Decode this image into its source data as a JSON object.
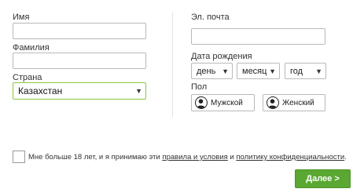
{
  "form": {
    "first_name_label": "Имя",
    "first_name_value": "",
    "last_name_label": "Фамилия",
    "last_name_value": "",
    "country_label": "Страна",
    "country_value": "Казахстан",
    "email_label": "Эл. почта",
    "email_value": "",
    "dob_label": "Дата рождения",
    "dob_day": "день",
    "dob_month": "месяц",
    "dob_year": "год",
    "gender_label": "Пол",
    "gender_male": "Мужской",
    "gender_female": "Женский",
    "consent_prefix": "Мне больше 18 лет, и я принимаю эти ",
    "consent_terms_link": "правила и условия",
    "consent_and": " и ",
    "consent_privacy_link": "политику конфиденциальности",
    "consent_suffix": ".",
    "next_button": "Далее >"
  },
  "colors": {
    "accent": "#5aa832",
    "country_border": "#8dc63f"
  },
  "icons": {
    "select_arrow": "chevron-down-icon",
    "gender": "person-icon"
  }
}
